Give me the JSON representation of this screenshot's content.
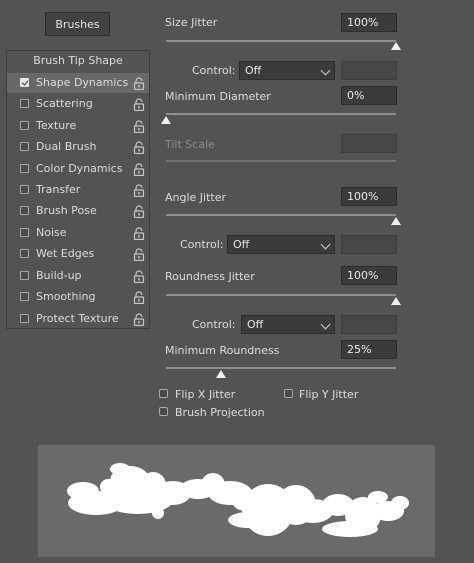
{
  "header": {
    "brushes_button": "Brushes"
  },
  "sidebar": {
    "title": "Brush Tip Shape",
    "items": [
      {
        "label": "Shape Dynamics",
        "checked": true,
        "selected": true
      },
      {
        "label": "Scattering",
        "checked": false
      },
      {
        "label": "Texture",
        "checked": false
      },
      {
        "label": "Dual Brush",
        "checked": false
      },
      {
        "label": "Color Dynamics",
        "checked": false
      },
      {
        "label": "Transfer",
        "checked": false
      },
      {
        "label": "Brush Pose",
        "checked": false
      },
      {
        "label": "Noise",
        "checked": false
      },
      {
        "label": "Wet Edges",
        "checked": false
      },
      {
        "label": "Build-up",
        "checked": false
      },
      {
        "label": "Smoothing",
        "checked": false
      },
      {
        "label": "Protect Texture",
        "checked": false
      }
    ]
  },
  "settings": {
    "size_jitter": {
      "label": "Size Jitter",
      "value": "100%",
      "slider_percent": 100
    },
    "size_control": {
      "label": "Control:",
      "value": "Off"
    },
    "min_diameter": {
      "label": "Minimum Diameter",
      "value": "0%",
      "slider_percent": 0
    },
    "tilt_scale": {
      "label": "Tilt Scale"
    },
    "angle_jitter": {
      "label": "Angle Jitter",
      "value": "100%",
      "slider_percent": 100
    },
    "angle_control": {
      "label": "Control:",
      "value": "Off"
    },
    "roundness_jitter": {
      "label": "Roundness Jitter",
      "value": "100%",
      "slider_percent": 100
    },
    "roundness_control": {
      "label": "Control:",
      "value": "Off"
    },
    "min_roundness": {
      "label": "Minimum Roundness",
      "value": "25%",
      "slider_percent": 25
    },
    "flip_x": {
      "label": "Flip X Jitter",
      "checked": false
    },
    "flip_y": {
      "label": "Flip Y Jitter",
      "checked": false
    },
    "brush_projection": {
      "label": "Brush Projection",
      "checked": false
    }
  },
  "colors": {
    "panel_bg": "#535353",
    "selected_row": "#686868",
    "preview_bg": "#6a6a6a"
  }
}
